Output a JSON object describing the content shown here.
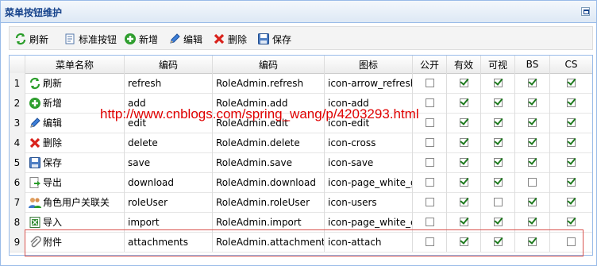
{
  "panel": {
    "title": "菜单按钮维护"
  },
  "toolbar": {
    "refresh": "刷新",
    "standard": "标准按钮",
    "add": "新增",
    "edit": "编辑",
    "delete": "删除",
    "save": "保存"
  },
  "grid": {
    "headers": [
      "菜单名称",
      "编码",
      "编码",
      "图标",
      "公开",
      "有效",
      "可视",
      "BS",
      "CS"
    ],
    "rows": [
      {
        "num": "1",
        "name": "刷新",
        "icon": "refresh-icon",
        "code": "refresh",
        "full": "RoleAdmin.refresh",
        "icon_text": "icon-arrow_refresh",
        "checks": [
          false,
          true,
          true,
          true,
          true
        ]
      },
      {
        "num": "2",
        "name": "新增",
        "icon": "add-icon",
        "code": "add",
        "full": "RoleAdmin.add",
        "icon_text": "icon-add",
        "checks": [
          false,
          true,
          true,
          true,
          true
        ]
      },
      {
        "num": "3",
        "name": "编辑",
        "icon": "edit-icon",
        "code": "edit",
        "full": "RoleAdmin.edit",
        "icon_text": "icon-edit",
        "checks": [
          false,
          true,
          true,
          true,
          true
        ]
      },
      {
        "num": "4",
        "name": "删除",
        "icon": "delete-icon",
        "code": "delete",
        "full": "RoleAdmin.delete",
        "icon_text": "icon-cross",
        "checks": [
          false,
          true,
          true,
          true,
          true
        ]
      },
      {
        "num": "5",
        "name": "保存",
        "icon": "save-icon",
        "code": "save",
        "full": "RoleAdmin.save",
        "icon_text": "icon-save",
        "checks": [
          false,
          true,
          true,
          true,
          true
        ]
      },
      {
        "num": "6",
        "name": "导出",
        "icon": "export-icon",
        "code": "download",
        "full": "RoleAdmin.download",
        "icon_text": "icon-page_white_g",
        "checks": [
          false,
          true,
          true,
          false,
          true
        ]
      },
      {
        "num": "7",
        "name": "角色用户关联关",
        "icon": "users-icon",
        "code": "roleUser",
        "full": "RoleAdmin.roleUser",
        "icon_text": "icon-users",
        "checks": [
          false,
          true,
          false,
          true,
          true
        ]
      },
      {
        "num": "8",
        "name": "导入",
        "icon": "import-icon",
        "code": "import",
        "full": "RoleAdmin.import",
        "icon_text": "icon-page_white_e",
        "checks": [
          false,
          true,
          true,
          true,
          true
        ]
      },
      {
        "num": "9",
        "name": "附件",
        "icon": "attach-icon",
        "code": "attachments",
        "full": "RoleAdmin.attachments",
        "icon_text": "icon-attach",
        "checks": [
          false,
          true,
          true,
          true,
          false
        ]
      }
    ]
  },
  "watermark": "http://www.cnblogs.com/spring_wang/p/4203293.html",
  "colors": {
    "header_text": "#15428b",
    "border": "#99bbe8",
    "watermark": "#e00000",
    "highlight": "#d9534f"
  }
}
